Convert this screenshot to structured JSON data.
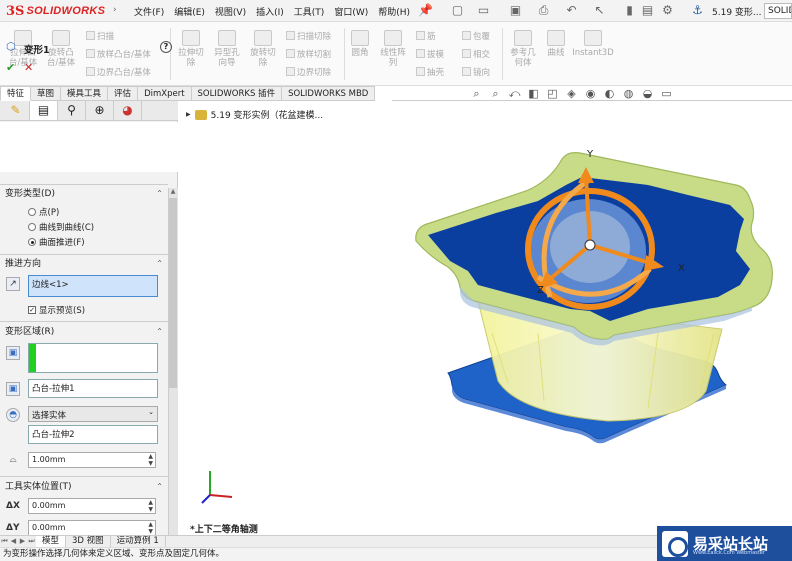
{
  "app": {
    "brand_prefix": "3S",
    "brand": "SOLIDWORKS"
  },
  "menu": [
    "文件(F)",
    "编辑(E)",
    "视图(V)",
    "插入(I)",
    "工具(T)",
    "窗口(W)",
    "帮助(H)"
  ],
  "document_title": "5.19 变形...",
  "help_search": "SOLIDWORKS帮助",
  "ribbon": {
    "extrude_boss": "拉伸凸\n台/基体",
    "revolve_boss": "旋转凸\n台/基体",
    "sweep": "扫描",
    "loft": "放样凸台/基体",
    "boundary": "边界凸台/基体",
    "extrude_cut": "拉伸切\n除",
    "hole_wizard": "异型孔\n向导",
    "revolve_cut": "旋转切\n除",
    "sweep_cut": "扫描切除",
    "loft_cut": "放样切割",
    "boundary_cut": "边界切除",
    "fillet": "圆角",
    "linear_pattern": "线性阵\n列",
    "rib": "筋",
    "draft": "拔模",
    "shell": "抽壳",
    "wrap": "包覆",
    "intersect": "相交",
    "mirror": "镜向",
    "ref_geometry": "参考几\n何体",
    "curves": "曲线",
    "instant3d": "Instant3D"
  },
  "tabs": [
    "特征",
    "草图",
    "模具工具",
    "评估",
    "DimXpert",
    "SOLIDWORKS 插件",
    "SOLIDWORKS MBD"
  ],
  "tree": {
    "root": "5.19 变形实例（花盆建模..."
  },
  "pm": {
    "title": "变形1",
    "help": "?",
    "deform_type": {
      "label": "变形类型(D)",
      "options": [
        "点(P)",
        "曲线到曲线(C)",
        "曲面推进(F)"
      ],
      "selected": "曲面推进(F)"
    },
    "push_direction": {
      "label": "推进方向",
      "value": "边线<1>",
      "preview": "显示预览(S)",
      "preview_checked": true
    },
    "deform_region": {
      "label": "变形区域(R)",
      "region_value": "",
      "body_value": "凸台-拉伸1",
      "select_body": "选择实体",
      "tool_body": "凸台-拉伸2",
      "distance": "1.00mm"
    },
    "tool_position": {
      "label": "工具实体位置(T)",
      "dx": "0.00mm",
      "dy": "0.00mm",
      "dx_label": "ΔX",
      "dy_label": "ΔY"
    }
  },
  "viewport": {
    "view_name": "*上下二等角轴测",
    "axes": {
      "x": "X",
      "y": "Y",
      "z": "Z"
    }
  },
  "bottom_tabs": [
    "模型",
    "3D 视图",
    "运动算例 1"
  ],
  "status": "为变形操作选择几何体来定义区域、变形点及固定几何体。",
  "watermark": {
    "name": "易采站长站",
    "sub": "Www.Easck.Com  Webmaster"
  },
  "colors": {
    "brand_red": "#d22222",
    "blue_dark": "#0b3fa0",
    "orange": "#f08a1c",
    "yellow": "#e9e98a"
  }
}
